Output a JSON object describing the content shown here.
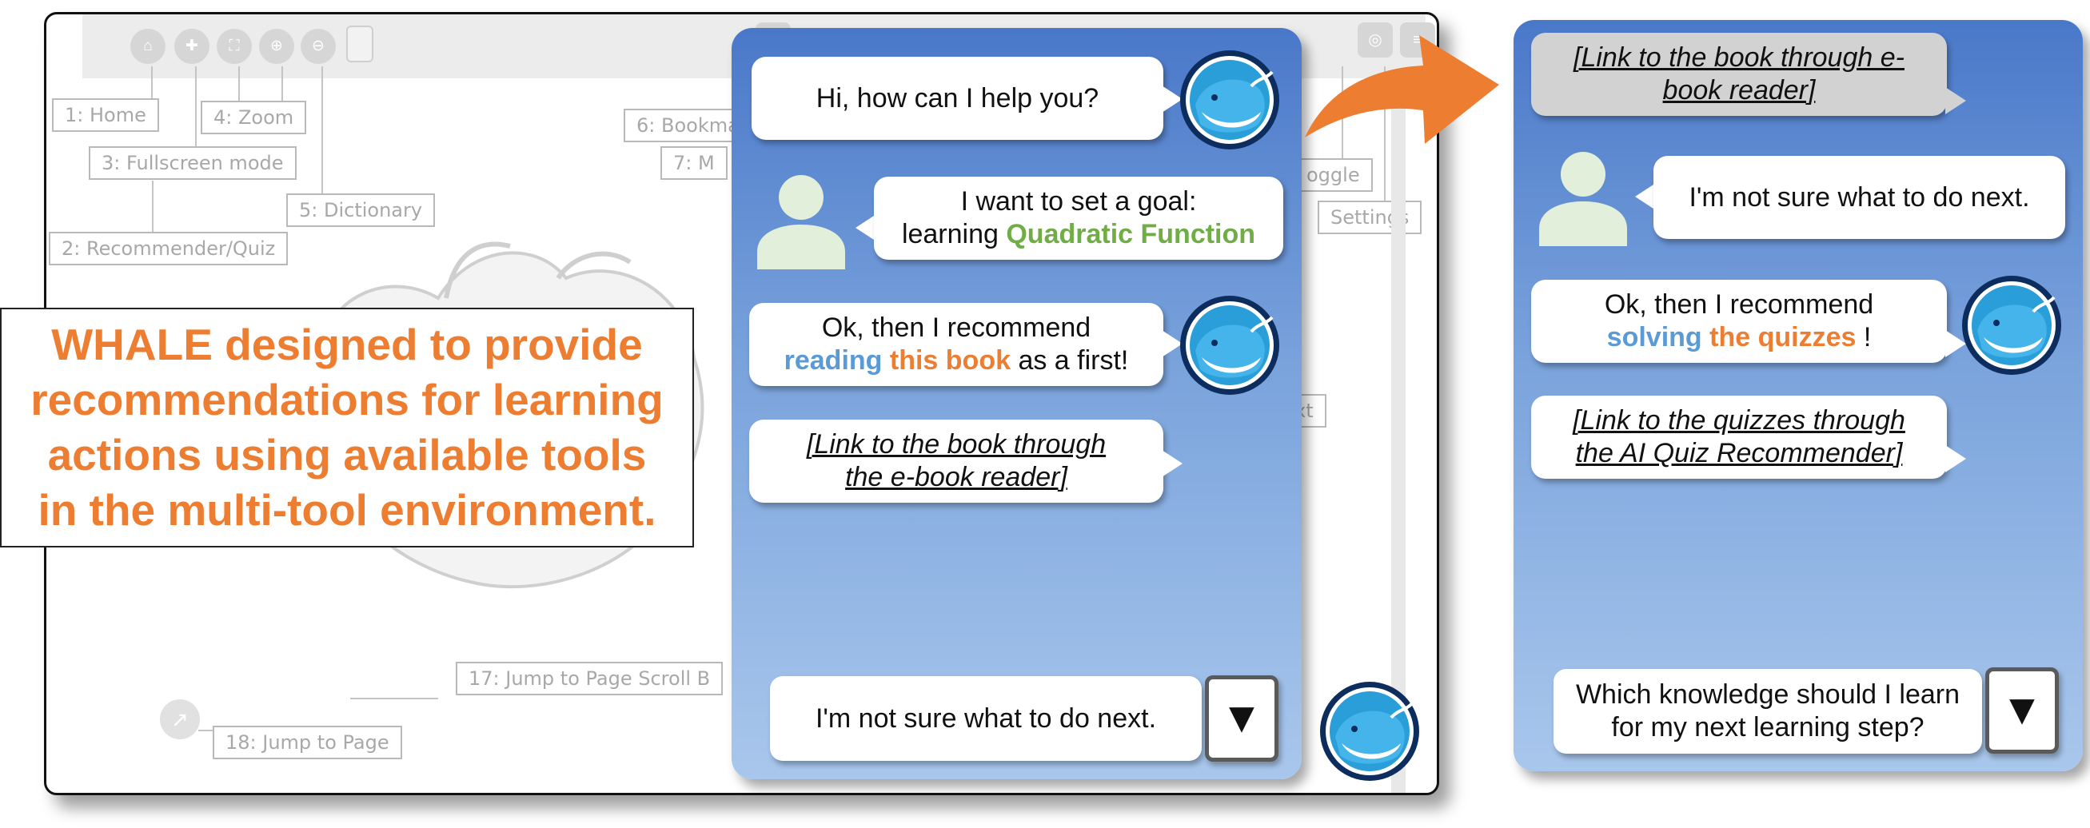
{
  "reader": {
    "toolbar_icons": [
      "home-icon",
      "plus-circle-icon",
      "fullscreen-icon",
      "zoom-in-icon",
      "zoom-out-icon",
      "dictionary-icon",
      "bookmark-icon",
      "eye-off-icon",
      "menu-icon"
    ],
    "annotations": {
      "home": "1: Home",
      "recommender": "2: Recommender/Quiz",
      "fullscreen": "3: Fullscreen mode",
      "zoom": "4: Zoom",
      "dictionary": "5: Dictionary",
      "bookmark": "6: Bookma",
      "seventh": "7: M",
      "toggle": "oggle",
      "settings": "Settings",
      "next": "xt",
      "jump_scroll": "17: Jump to Page Scroll B",
      "jump_page": "18: Jump to Page"
    }
  },
  "caption": {
    "text": "WHALE designed to provide\nrecommendations for learning\nactions using available tools\nin the multi-tool environment."
  },
  "panel1": {
    "bot_greeting": "Hi, how can I help you?",
    "user_goal": {
      "line1": "I want to set a goal:",
      "prefix": "learning ",
      "highlight": "Quadratic Function"
    },
    "bot_recommend": {
      "line1": "Ok, then I recommend",
      "blue": "reading",
      "orange": "this book",
      "suffix": " as a first!"
    },
    "link": {
      "line1": "[Link to the book through",
      "line2": "the e-book reader]"
    },
    "input_text": "I'm not sure what to do next.",
    "send_symbol": "▼"
  },
  "panel2": {
    "link_book": {
      "line1": "[Link to the book through e-",
      "line2": "book reader]"
    },
    "user_msg": "I'm not sure what to do next.",
    "bot_recommend": {
      "line1": "Ok, then I recommend",
      "blue": "solving",
      "orange": "the quizzes",
      "suffix": " !"
    },
    "link_quiz": {
      "line1": "[Link to the quizzes through",
      "line2": "the AI Quiz Recommender]"
    },
    "input": {
      "line1": "Which knowledge should I learn",
      "line2": "for my next learning step?"
    },
    "send_symbol": "▼"
  },
  "colors": {
    "accent_orange": "#ed7d31",
    "accent_blue": "#5b9bd5",
    "accent_green": "#70ad47",
    "panel_top": "#4a78c9",
    "panel_bottom": "#a9c7ec"
  }
}
